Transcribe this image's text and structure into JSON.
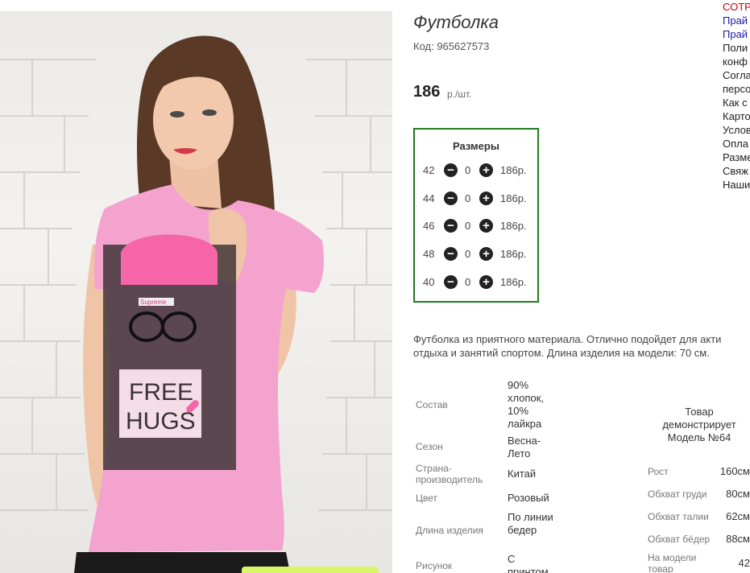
{
  "product": {
    "title": "Футболка",
    "code": "Код: 965627573",
    "price": "186",
    "price_unit": "р./шт."
  },
  "photo": {
    "print_line1": "FREE",
    "print_line2": "HUGS",
    "hat_label": "Supreme"
  },
  "sizes": {
    "title": "Размеры",
    "rows": [
      {
        "size": "42",
        "qty": "0",
        "price": "186р."
      },
      {
        "size": "44",
        "qty": "0",
        "price": "186р."
      },
      {
        "size": "46",
        "qty": "0",
        "price": "186р."
      },
      {
        "size": "48",
        "qty": "0",
        "price": "186р."
      },
      {
        "size": "40",
        "qty": "0",
        "price": "186р."
      }
    ]
  },
  "description": {
    "line1": "Футболка из приятного материала. Отлично подойдет для акти",
    "line2": "отдыха и занятий спортом. Длина изделия на модели: 70 см."
  },
  "attributes": [
    {
      "label": "Состав",
      "value": "90% хлопок, 10% лайкра"
    },
    {
      "label": "Сезон",
      "value": "Весна-Лето"
    },
    {
      "label": "Страна-производитель",
      "value": "Китай"
    },
    {
      "label": "Цвет",
      "value": "Розовый"
    },
    {
      "label": "Длина изделия",
      "value": "По линии бедер"
    },
    {
      "label": "Рисунок",
      "value": "С принтом"
    }
  ],
  "model": {
    "heading": "Товар демонстрирует Модель №64",
    "rows": [
      {
        "label": "Рост",
        "value": "160см"
      },
      {
        "label": "Обхват груди",
        "value": "80см"
      },
      {
        "label": "Обхват талии",
        "value": "62см"
      },
      {
        "label": "Обхват бёдер",
        "value": "88см"
      },
      {
        "label": "На модели товар",
        "value": "42"
      }
    ]
  },
  "side_menu": [
    "СОТР",
    "Прай",
    "Прай",
    "Поли",
    "конф",
    "Согла",
    "персо",
    "Как с",
    "Карто",
    "Услов",
    "Опла",
    "Разме",
    "Свяж",
    "Наши"
  ],
  "colors": {
    "frame_green": "#1f7a1f",
    "shirt_pink": "#f4a3cf",
    "menu_red": "#d00000",
    "menu_blue": "#1a1aa6"
  }
}
